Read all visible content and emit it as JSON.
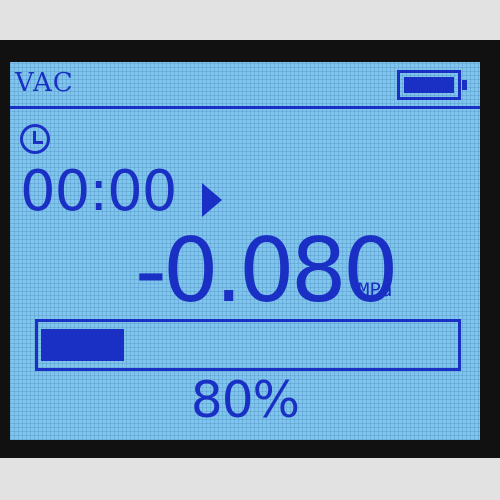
{
  "header": {
    "mode_label": "VAC",
    "battery_icon": "battery-full-icon"
  },
  "timer": {
    "clock_icon": "clock-icon",
    "value": "00:00",
    "state_icon": "play-icon"
  },
  "reading": {
    "value": "-0.080",
    "unit": "MPa"
  },
  "progress": {
    "fill_fraction": 0.2,
    "label": "80%"
  },
  "colors": {
    "lcd_background": "#7fc6ee",
    "segment_blue": "#1a2fc4",
    "bezel": "#111111"
  }
}
